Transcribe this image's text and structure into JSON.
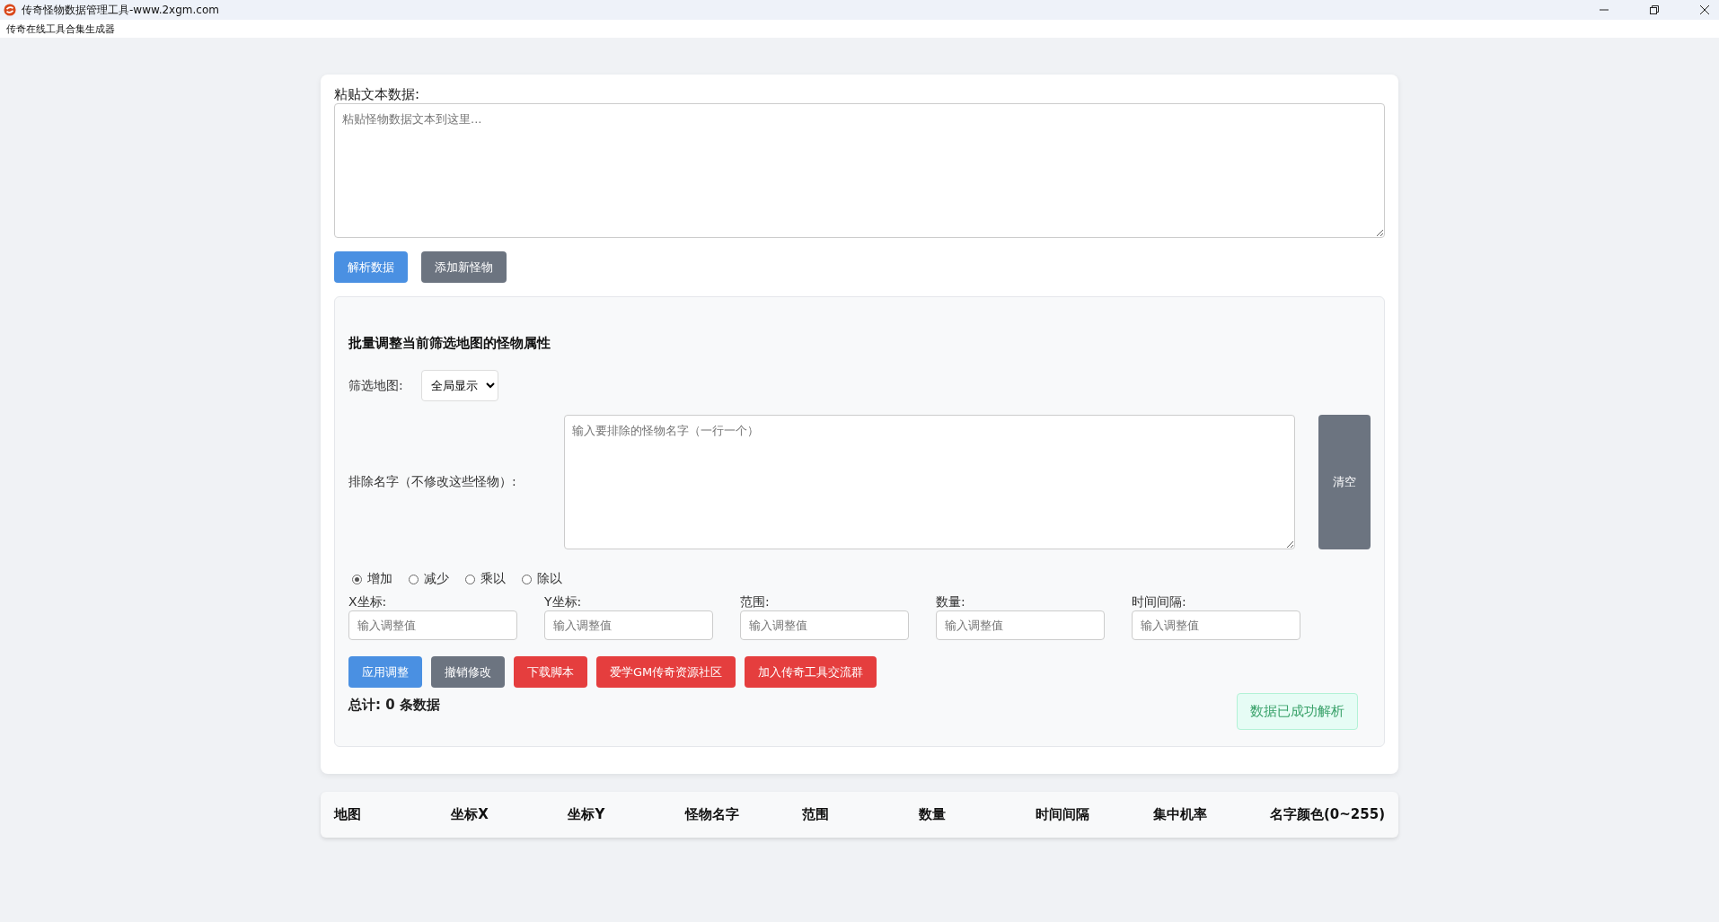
{
  "window": {
    "title": "传奇怪物数据管理工具-www.2xgm.com",
    "menu": "传奇在线工具合集生成器"
  },
  "paste": {
    "label": "粘贴文本数据:",
    "placeholder": "粘贴怪物数据文本到这里..."
  },
  "top_buttons": [
    {
      "label": "解析数据",
      "kind": "primary"
    },
    {
      "label": "添加新怪物",
      "kind": "secondary"
    }
  ],
  "batch": {
    "title": "批量调整当前筛选地图的怪物属性",
    "filter_label": "筛选地图:",
    "filter_value": "全局显示",
    "exclude_label": "排除名字（不修改这些怪物）:",
    "exclude_placeholder": "输入要排除的怪物名字（一行一个）",
    "clear_button": "清空",
    "operations": [
      {
        "label": "增加",
        "selected": true
      },
      {
        "label": "减少",
        "selected": false
      },
      {
        "label": "乘以",
        "selected": false
      },
      {
        "label": "除以",
        "selected": false
      }
    ],
    "fields": [
      {
        "label": "X坐标:",
        "placeholder": "输入调整值"
      },
      {
        "label": "Y坐标:",
        "placeholder": "输入调整值"
      },
      {
        "label": "范围:",
        "placeholder": "输入调整值"
      },
      {
        "label": "数量:",
        "placeholder": "输入调整值"
      },
      {
        "label": "时间间隔:",
        "placeholder": "输入调整值"
      }
    ],
    "actions": [
      {
        "label": "应用调整",
        "kind": "primary"
      },
      {
        "label": "撤销修改",
        "kind": "secondary"
      },
      {
        "label": "下载脚本",
        "kind": "danger"
      },
      {
        "label": "爱学GM传奇资源社区",
        "kind": "danger"
      },
      {
        "label": "加入传奇工具交流群",
        "kind": "danger"
      }
    ],
    "total": "总计: 0 条数据",
    "status": "数据已成功解析"
  },
  "table": {
    "columns": [
      "地图",
      "坐标X",
      "坐标Y",
      "怪物名字",
      "范围",
      "数量",
      "时间间隔",
      "集中机率",
      "名字颜色(0~255)"
    ]
  }
}
